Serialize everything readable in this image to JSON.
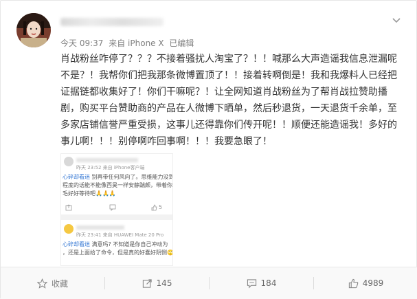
{
  "post": {
    "meta_time": "今天 09:37",
    "meta_source": "来自 iPhone X",
    "meta_edited": "已编辑",
    "text": "肖战粉丝咋停了？？？不接着骚扰人淘宝了？！！喊那么大声造谣我信息泄漏呢不是？！我帮你们把我那条微博置顶了！！接着转啊倒是！我和我爆料人已经把证据链都收集好了！你们干嘛呢？！让全网知道肖战粉丝为了帮肖战拉赞助播剧，购买平台赞助商的产品在人微博下晒单，然后秒退货，一天退货千余单，至多家店铺信誉严重受损，这事儿还得靠你们传开呢！！顺便还能造谣我！多好的事儿啊！！！别停啊咋回事啊！！！我要急眼了！"
  },
  "screenshot": {
    "c1_meta": "昨天 23:52 来自 iPhone客户端",
    "c1_name": "心碎却看迷",
    "c1_line1": "别再带任何风向了。思维能力没到",
    "c1_line2": "程度的话能不能像西昊一样安静踹颇，带着你",
    "c1_line3": "毛好好等待吧🙏🙏🙏",
    "c1_like": "5",
    "c2_meta": "昨天 23:41 来自 HUAWEI Mate 20 Pro",
    "c2_name": "心碎却看迷",
    "c2_line1": "满意吗? 不知道是你自己冲动为",
    "c2_line2": "，还是上面给了命令，但是真的好蠢好阴恻🙄"
  },
  "toolbar": {
    "favorite_label": "收藏",
    "repost_count": "145",
    "comment_count": "184",
    "like_count": "4989"
  }
}
